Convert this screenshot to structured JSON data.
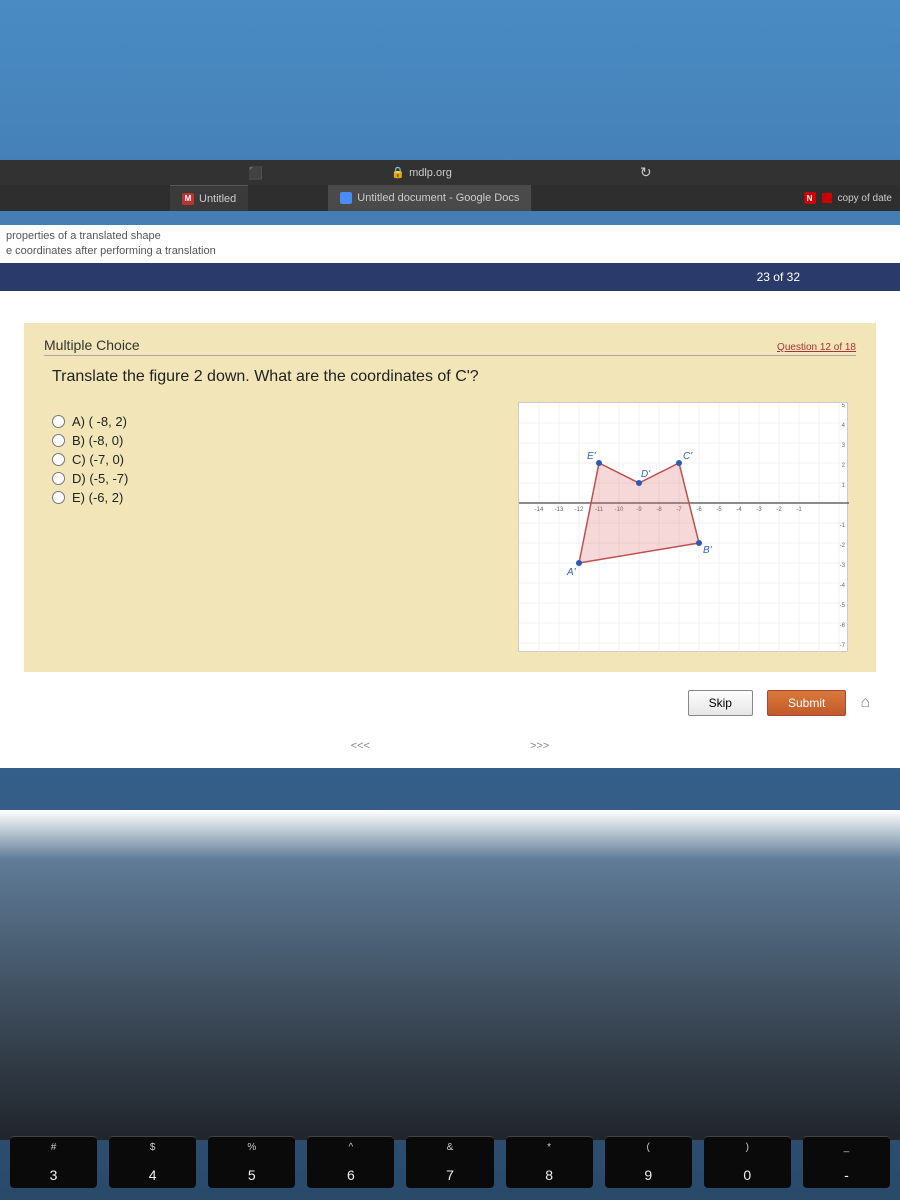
{
  "browser": {
    "url_host": "mdlp.org",
    "tabs": [
      {
        "favicon": "M",
        "label": "Untitled"
      },
      {
        "favicon": "doc",
        "label": "Untitled document - Google Docs"
      }
    ],
    "tab_right_label": "copy of date"
  },
  "breadcrumb": {
    "line1": "properties of a translated shape",
    "line2": "e coordinates after performing a translation"
  },
  "progress": "23 of 32",
  "question": {
    "type_label": "Multiple Choice",
    "counter": "Question 12 of 18",
    "prompt": "Translate the figure 2 down. What are the coordinates of C'?",
    "choices": [
      "A) ( -8, 2)",
      "B) (-8, 0)",
      "C) (-7, 0)",
      "D) (-5, -7)",
      "E) (-6, 2)"
    ]
  },
  "graph": {
    "x_ticks": [
      "-14",
      "-13",
      "-12",
      "-11",
      "-10",
      "-9",
      "-8",
      "-7",
      "-6",
      "-5",
      "-4",
      "-3",
      "-2",
      "-1"
    ],
    "y_ticks_pos": [
      "5",
      "4",
      "3",
      "2",
      "1"
    ],
    "y_ticks_neg": [
      "-1",
      "-2",
      "-3",
      "-4",
      "-5",
      "-6",
      "-7"
    ],
    "points": {
      "A_prime": {
        "x": -12,
        "y": -3,
        "label": "A'"
      },
      "B_prime": {
        "x": -6,
        "y": -2,
        "label": "B'"
      },
      "C_prime": {
        "x": -7,
        "y": 2,
        "label": "C'"
      },
      "D_prime": {
        "x": -9,
        "y": 1,
        "label": "D'"
      },
      "E_prime": {
        "x": -11,
        "y": 2,
        "label": "E'"
      }
    }
  },
  "controls": {
    "skip": "Skip",
    "submit": "Submit",
    "prev": "<<<",
    "next": ">>>"
  },
  "keyboard": [
    {
      "upper": "#",
      "lower": "3"
    },
    {
      "upper": "$",
      "lower": "4"
    },
    {
      "upper": "%",
      "lower": "5"
    },
    {
      "upper": "^",
      "lower": "6"
    },
    {
      "upper": "&",
      "lower": "7"
    },
    {
      "upper": "*",
      "lower": "8"
    },
    {
      "upper": "(",
      "lower": "9"
    },
    {
      "upper": ")",
      "lower": "0"
    },
    {
      "upper": "_",
      "lower": "-"
    }
  ]
}
